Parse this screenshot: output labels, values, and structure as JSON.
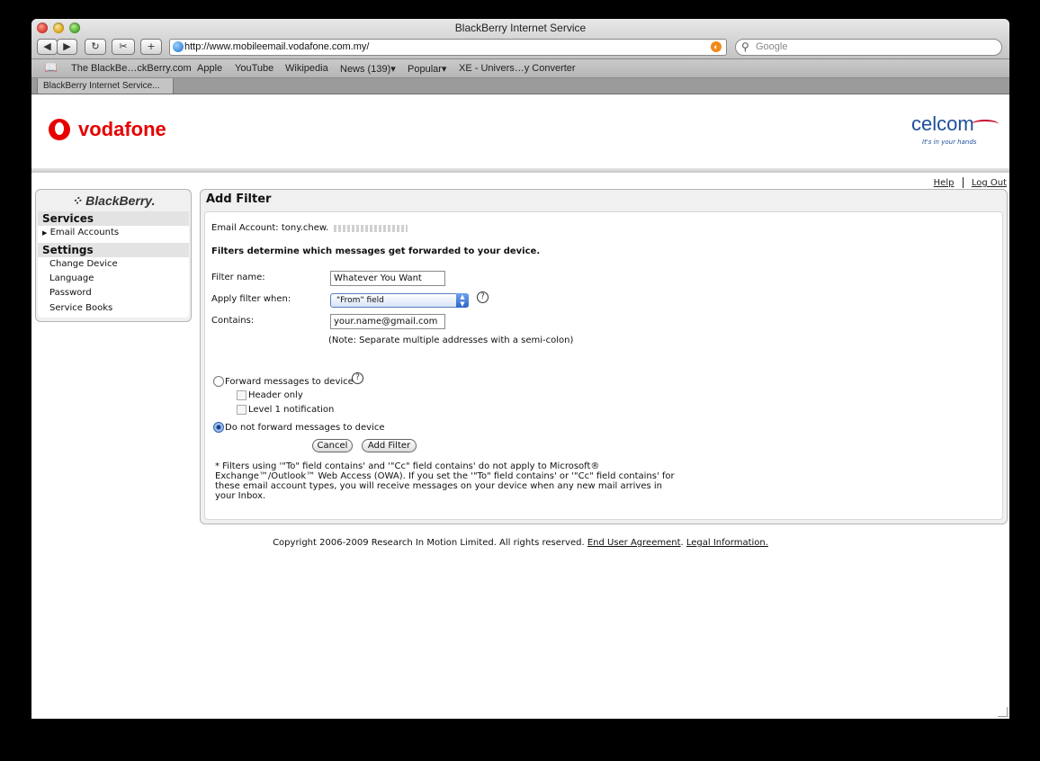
{
  "window": {
    "title": "BlackBerry Internet Service"
  },
  "toolbar": {
    "back_label": "◀",
    "forward_label": "▶",
    "reload_label": "↻",
    "snip_label": "✂",
    "add_label": "+",
    "url": "http://www.mobileemail.vodafone.com.my/",
    "search_placeholder": "Google"
  },
  "bookmarks": [
    "The BlackBe…ckBerry.com",
    "Apple",
    "YouTube",
    "Wikipedia",
    "News (139)▾",
    "Popular▾",
    "XE - Univers…y Converter"
  ],
  "tab": {
    "label": "BlackBerry Internet Service..."
  },
  "banner": {
    "vodafone": "vodafone",
    "celcom": "celcom",
    "celcom_tagline": "It's in your hands"
  },
  "toplinks": {
    "help": "Help",
    "logout": "Log Out"
  },
  "sidebar": {
    "brand": "BlackBerry.",
    "services_heading": "Services",
    "services_items": [
      "Email Accounts"
    ],
    "settings_heading": "Settings",
    "settings_items": [
      "Change Device",
      "Language",
      "Password",
      "Service Books"
    ]
  },
  "form": {
    "title": "Add Filter",
    "email_account_label": "Email Account: tony.chew.",
    "intro": "Filters determine which messages get forwarded to your device.",
    "filter_name_label": "Filter name:",
    "filter_name_value": "Whatever You Want",
    "apply_when_label": "Apply filter when:",
    "apply_when_value": "\"From\" field",
    "contains_label": "Contains:",
    "contains_value": "your.name@gmail.com",
    "contains_note": "(Note: Separate multiple addresses with a semi-colon)",
    "forward_label": "Forward messages to device",
    "header_only_label": "Header only",
    "level1_label": "Level 1 notification",
    "do_not_forward_label": "Do not forward messages to device",
    "forward_selected": "do_not_forward",
    "cancel_label": "Cancel",
    "add_filter_label": "Add Filter",
    "footnote": "* Filters using '\"To\" field contains' and '\"Cc\" field contains' do not apply to Microsoft® Exchange™/Outlook™ Web Access (OWA). If you set the '\"To\" field contains' or '\"Cc\" field contains' for these email account types, you will receive messages on your device when any new mail arrives in your Inbox."
  },
  "footer": {
    "copyright": "Copyright 2006-2009 Research In Motion Limited. All rights reserved.",
    "eula": "End User Agreement",
    "legal": "Legal Information."
  }
}
